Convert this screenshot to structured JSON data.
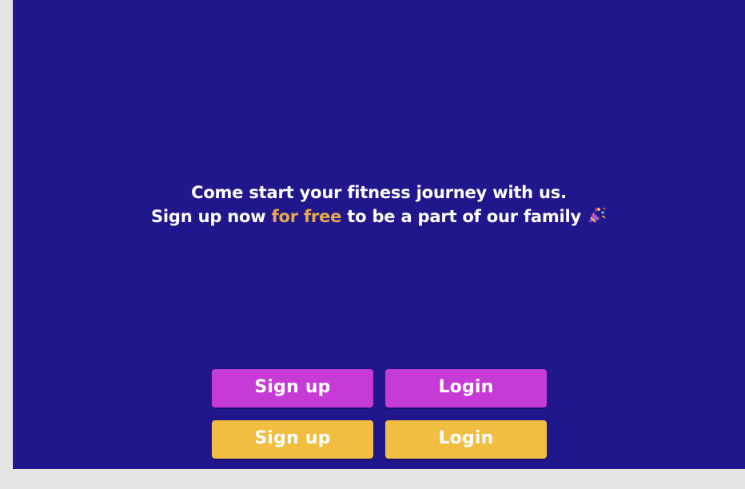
{
  "hero": {
    "line1": "Come start your fitness journey with us.",
    "line2_prefix": "Sign up now ",
    "line2_accent": "for free",
    "line2_suffix": " to be a part of our family",
    "emoji_icon": "party-popper-icon"
  },
  "buttons": {
    "primary": {
      "signup_label": "Sign up",
      "login_label": "Login"
    },
    "secondary": {
      "signup_label": "Sign up",
      "login_label": "Login"
    }
  },
  "colors": {
    "background": "#21178c",
    "accent_text": "#e4a94f",
    "purple_button": "#c63bd6",
    "yellow_button": "#f1be42"
  }
}
